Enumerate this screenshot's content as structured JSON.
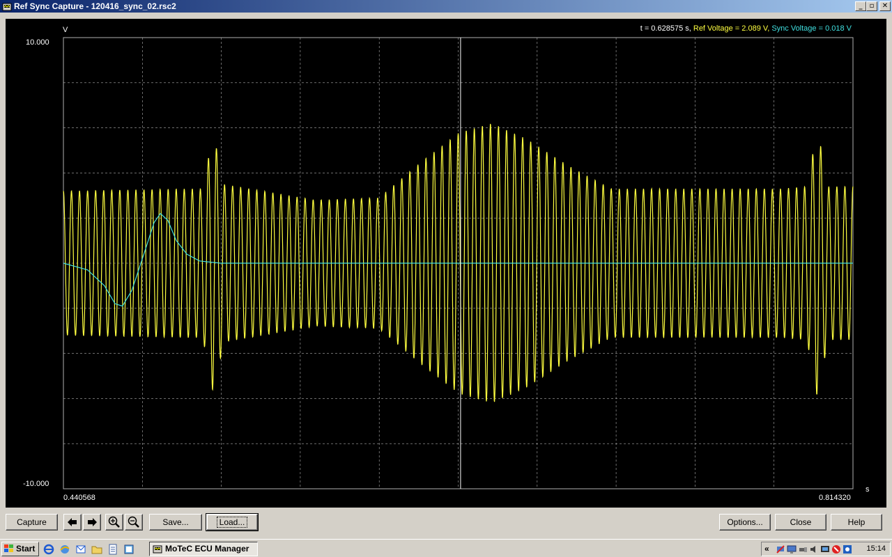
{
  "window": {
    "title": "Ref Sync Capture - 120416_sync_02.rsc2",
    "controls": {
      "minimize": "_",
      "maximize": "▫",
      "close": "✕"
    }
  },
  "plot": {
    "y_unit": "V",
    "x_unit": "s",
    "y_max_label": "10.000",
    "y_min_label": "-10.000",
    "x_min_label": "0.440568",
    "x_max_label": "0.814320",
    "readout": {
      "time": "t = 0.628575 s,",
      "ref": "Ref Voltage =  2.089 V,",
      "sync": "Sync Voltage =  0.018 V"
    },
    "colors": {
      "ref": "#ffff40",
      "sync": "#40e0e0",
      "grid": "#b0b0b0",
      "cursor": "#ffffff"
    }
  },
  "chart_data": {
    "type": "line",
    "x_range": [
      0.440568,
      0.81432
    ],
    "ylim": [
      -10,
      10
    ],
    "y_unit": "V",
    "x_unit": "s",
    "grid": true,
    "grid_divisions": {
      "x": 10,
      "y": 10
    },
    "cursor_x": 0.628575,
    "series": [
      {
        "name": "Ref Voltage",
        "color": "#ffff40",
        "cycles": 98,
        "envelope": [
          [
            0.440568,
            3.2
          ],
          [
            0.5,
            3.3
          ],
          [
            0.5065,
            3.3
          ],
          [
            0.5115,
            5.8
          ],
          [
            0.5165,
            3.5
          ],
          [
            0.56,
            2.8
          ],
          [
            0.59,
            2.9
          ],
          [
            0.61,
            4.5
          ],
          [
            0.628,
            5.8
          ],
          [
            0.6435,
            6.2
          ],
          [
            0.66,
            5.5
          ],
          [
            0.68,
            4.3
          ],
          [
            0.7,
            3.3
          ],
          [
            0.78,
            3.3
          ],
          [
            0.7925,
            3.4
          ],
          [
            0.7975,
            6.0
          ],
          [
            0.8025,
            3.4
          ],
          [
            0.81432,
            3.4
          ]
        ]
      },
      {
        "name": "Sync Voltage",
        "color": "#40e0e0",
        "points": [
          [
            0.440568,
            0.0
          ],
          [
            0.452,
            -0.3
          ],
          [
            0.46,
            -1.0
          ],
          [
            0.465,
            -1.8
          ],
          [
            0.4685,
            -1.9
          ],
          [
            0.473,
            -1.2
          ],
          [
            0.479,
            0.5
          ],
          [
            0.4835,
            1.8
          ],
          [
            0.4865,
            2.2
          ],
          [
            0.49,
            1.9
          ],
          [
            0.494,
            1.0
          ],
          [
            0.499,
            0.4
          ],
          [
            0.505,
            0.1
          ],
          [
            0.515,
            0.0
          ],
          [
            0.81432,
            0.0
          ]
        ]
      }
    ]
  },
  "toolbar": {
    "capture": "Capture",
    "prev_icon": "arrow-left-icon",
    "next_icon": "arrow-right-icon",
    "zoom_in_icon": "zoom-in-icon",
    "zoom_out_icon": "zoom-out-icon",
    "save": "Save...",
    "load": "Load...",
    "options": "Options...",
    "close": "Close",
    "help": "Help"
  },
  "taskbar": {
    "start": "Start",
    "task_label": "MoTeC ECU Manager",
    "tray_chevron": "«",
    "clock": "15:14"
  }
}
